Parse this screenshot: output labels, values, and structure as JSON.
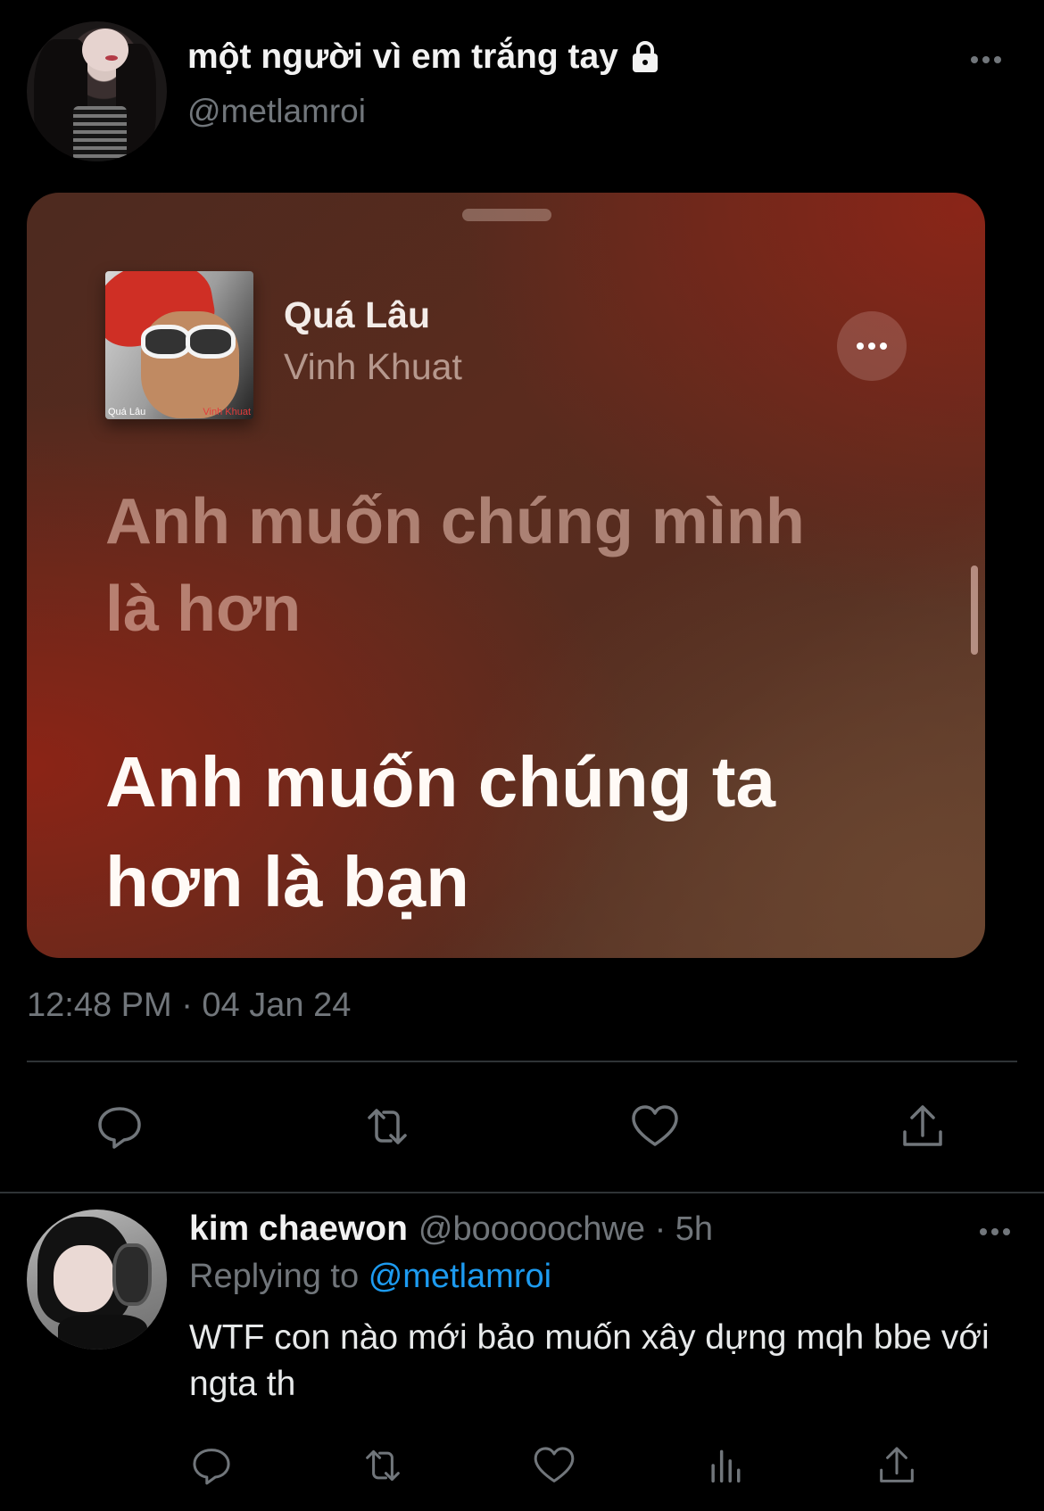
{
  "tweet": {
    "display_name": "một người vì em trắng tay",
    "handle": "@metlamroi",
    "timestamp": "12:48 PM · 04 Jan 24",
    "media": {
      "song_title": "Quá Lâu",
      "artist": "Vinh Khuat",
      "album_caption_left": "Quá Lâu",
      "album_caption_right": "Vinh Khuat",
      "lyric_previous": "Anh muốn chúng mình là hơn",
      "lyric_current": "Anh muốn chúng ta hơn là bạn"
    }
  },
  "reply": {
    "display_name": "kim chaewon",
    "meta": "@booooochwe · 5h",
    "replying_prefix": "Replying to",
    "replying_handle": "@metlamroi",
    "text": "WTF con nào mới bảo muốn xây dựng mqh bbe với ngta th"
  },
  "colors": {
    "background": "#000000",
    "muted_text": "#71767b",
    "link": "#1d9bf0",
    "divider": "#2f3336"
  },
  "icons": {
    "reply": "speech-bubble-icon",
    "retweet": "retweet-icon",
    "like": "heart-icon",
    "share": "share-icon",
    "views": "bar-chart-icon",
    "lock": "lock-icon",
    "more": "ellipsis-icon"
  }
}
